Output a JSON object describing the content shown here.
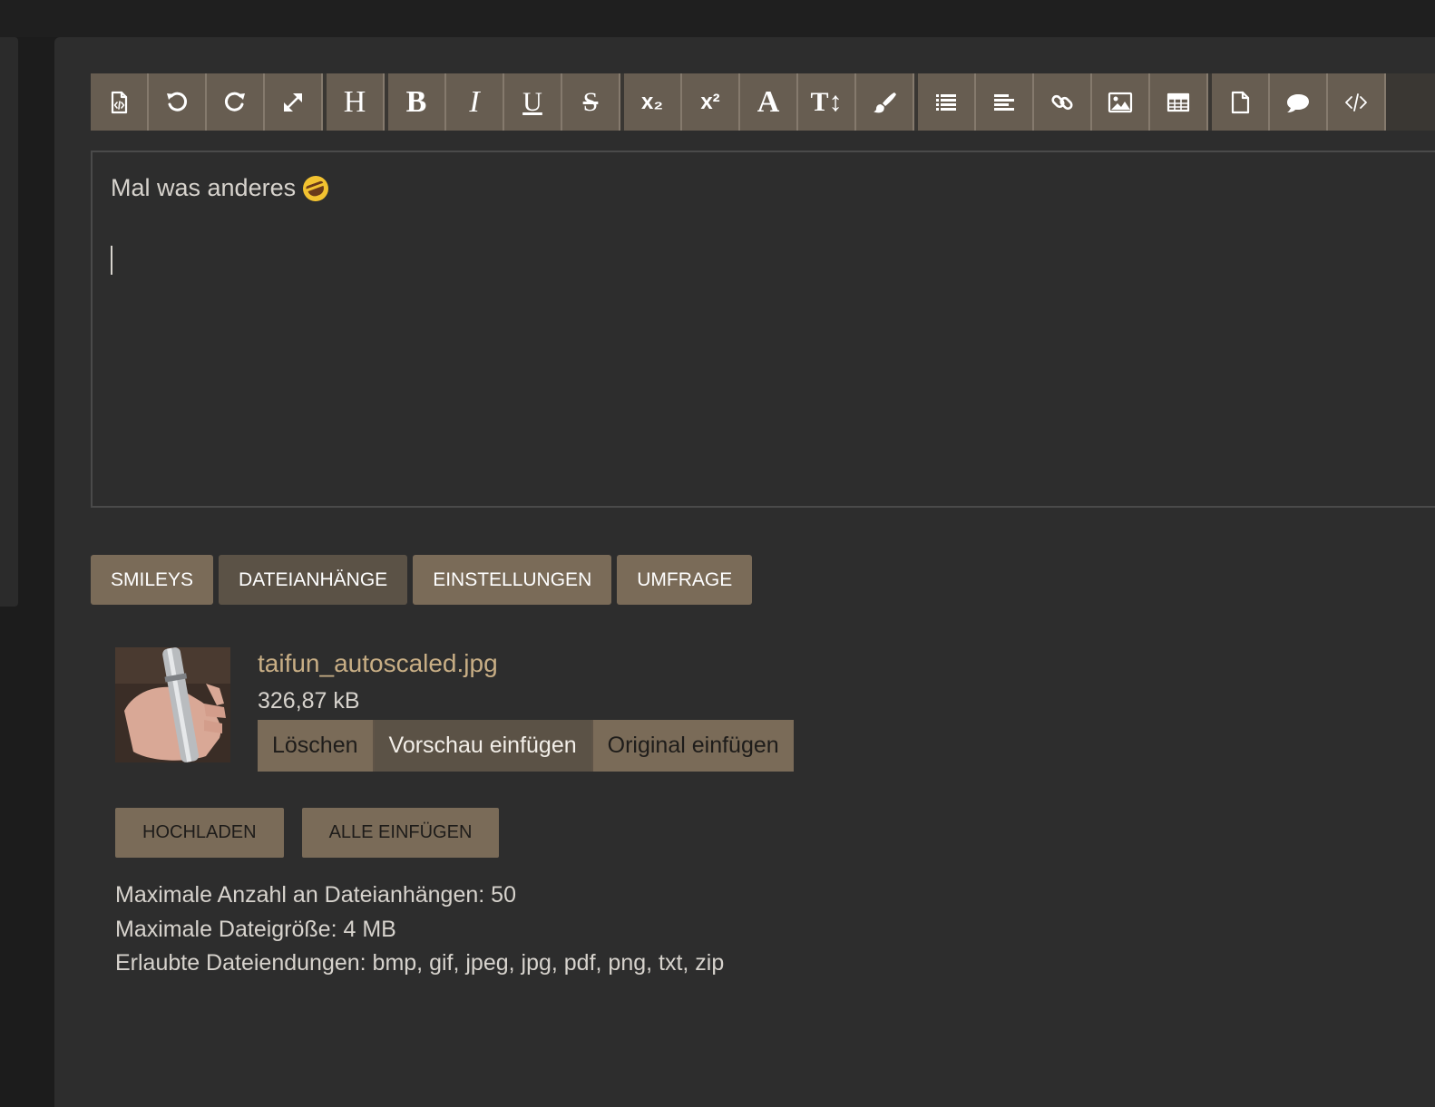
{
  "toolbar": {
    "heading_label": "H",
    "bold_label": "B",
    "italic_label": "I",
    "underline_label": "U",
    "strike_label": "S",
    "subscript_label": "x₂",
    "superscript_label": "x²",
    "font_label": "A",
    "size_label": "T↕",
    "icons": [
      "source-code-icon",
      "undo-icon",
      "redo-icon",
      "fullscreen-icon",
      "heading-icon",
      "bold-icon",
      "italic-icon",
      "underline-icon",
      "strikethrough-icon",
      "subscript-icon",
      "superscript-icon",
      "font-color-icon",
      "font-size-icon",
      "brush-icon",
      "list-icon",
      "align-icon",
      "link-icon",
      "image-icon",
      "table-icon",
      "page-icon",
      "quote-icon",
      "code-icon"
    ]
  },
  "editor": {
    "text": "Mal was anderes"
  },
  "tabs": {
    "smileys": "SMILEYS",
    "attachments": "DATEIANHÄNGE",
    "settings": "EINSTELLUNGEN",
    "poll": "UMFRAGE"
  },
  "attachment": {
    "name": "taifun_autoscaled.jpg",
    "size": "326,87 kB",
    "delete_label": "Löschen",
    "insert_preview_label": "Vorschau einfügen",
    "insert_original_label": "Original einfügen"
  },
  "buttons": {
    "upload": "HOCHLADEN",
    "insert_all": "ALLE EINFÜGEN"
  },
  "limits": {
    "max_count": "Maximale Anzahl an Dateianhängen: 50",
    "max_size": "Maximale Dateigröße: 4 MB",
    "extensions": "Erlaubte Dateiendungen: bmp, gif, jpeg, jpg, pdf, png, txt, zip"
  },
  "colors": {
    "accent": "#7a6b58",
    "accent_dark": "#5b5246",
    "link": "#c8ae85",
    "background": "#2d2d2d"
  }
}
